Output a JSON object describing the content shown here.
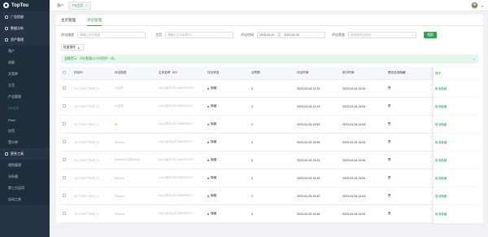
{
  "topbar": {
    "logo_text": "TopTou",
    "crumb_home": "落户",
    "crumb_tab": "FB主页",
    "crumb_tab_close": "×"
  },
  "sidebar": {
    "items": [
      {
        "label": "广告投放",
        "type": "group"
      },
      {
        "label": "数据分析",
        "type": "group"
      },
      {
        "label": "资产管理",
        "type": "group"
      },
      {
        "label": "落户",
        "type": "sub"
      },
      {
        "label": "创意",
        "type": "sub"
      },
      {
        "label": "文案库",
        "type": "sub"
      },
      {
        "label": "主页",
        "type": "sub"
      },
      {
        "label": "产品管理",
        "type": "sub"
      },
      {
        "label": "FB主页",
        "type": "sub",
        "active": true
      },
      {
        "label": "Pixel",
        "type": "sub"
      },
      {
        "label": "应用",
        "type": "sub"
      },
      {
        "label": "受众库",
        "type": "sub"
      },
      {
        "label": "更多工具",
        "type": "group"
      },
      {
        "label": "规则管理",
        "type": "sub"
      },
      {
        "label": "分析器",
        "type": "sub"
      },
      {
        "label": "第三方运用",
        "type": "sub"
      },
      {
        "label": "自动工具",
        "type": "sub"
      }
    ]
  },
  "tabs": [
    "主页管理",
    "评论管理"
  ],
  "filters": {
    "comment_label": "评论描述",
    "comment_placeholder": "请输入评论描述",
    "page_label": "主页",
    "page_placeholder": "请输入主页名称/ID",
    "time_label": "评论时间",
    "date_from": "2023-04-20",
    "date_to": "2023-04-26",
    "date_sep": "至",
    "status_label": "评论状态",
    "status_placeholder": "请选择评论状态",
    "search_button": "搜索"
  },
  "batch": {
    "label": "批量操作",
    "caret": "∨"
  },
  "alert": {
    "text": "温馨提示：评论数据12小时同步一次。",
    "close": "×"
  },
  "table": {
    "headers": [
      "",
      "评论ID",
      "评论描述",
      "主页名称（ID）",
      "评论状态",
      "点赞数",
      "评论时间",
      "执行时间",
      "是否支持隐藏",
      "操作"
    ],
    "rows": [
      {
        "id": "1071780773995_5...",
        "desc": "以后的",
        "page": "Lily以测试公司 11880498702?",
        "status": "隐藏",
        "likes": "0",
        "ctime": "2023-04-26 12:19",
        "etime": "2023-04-26 14:54",
        "hide": "是",
        "op": "取消隐藏"
      },
      {
        "id": "1071780773995_5...",
        "desc": "以后的",
        "page": "Lily以测试公司 11880498702?",
        "status": "隐藏",
        "likes": "0",
        "ctime": "2023-04-26 12:19",
        "etime": "2023-04-26 14:54",
        "hide": "是",
        "op": "取消隐藏"
      },
      {
        "id": "1071780773995_5...",
        "desc": "😀",
        "page": "Lily以测试公司 11880498702?",
        "status": "隐藏",
        "likes": "0",
        "ctime": "2023-04-25 15:59",
        "etime": "2023-04-26 14:54",
        "hide": "是",
        "op": "取消隐藏"
      },
      {
        "id": "1071780773995_5...",
        "desc": "Bulliant",
        "page": "Lily以测试公司 11880498702?",
        "status": "隐藏",
        "likes": "0",
        "ctime": "2023-04-25 15:59",
        "etime": "2023-04-26 14:54",
        "hide": "是",
        "op": "取消隐藏"
      },
      {
        "id": "1071780773995_5...",
        "desc": "Bulliant以后Bulliant",
        "page": "Lily以测试公司 11880498702?",
        "status": "隐藏",
        "likes": "0",
        "ctime": "2023-04-25 15:51",
        "etime": "2023-04-26 14:54",
        "hide": "是",
        "op": "取消隐藏"
      },
      {
        "id": "1071780773995_5...",
        "desc": "Bulliant",
        "page": "Lily以测试公司 11880498702?",
        "status": "隐藏",
        "likes": "0",
        "ctime": "2023-04-25 15:49",
        "etime": "2023-04-26 14:54",
        "hide": "是",
        "op": "取消隐藏"
      },
      {
        "id": "1071780773995_5...",
        "desc": "Bulliant",
        "page": "Lily以测试公司 11880498702?",
        "status": "隐藏",
        "likes": "0",
        "ctime": "2023-04-25 15:40",
        "etime": "2023-04-26 14:54",
        "hide": "是",
        "op": "取消隐藏"
      },
      {
        "id": "1071780773995_5...",
        "desc": "Bulliant",
        "page": "Lily以测试公司 11880498702?",
        "status": "隐藏",
        "likes": "0",
        "ctime": "2023-04-25 15:48",
        "etime": "2023-04-26 14:54",
        "hide": "是",
        "op": "取消隐藏"
      }
    ]
  },
  "colors": {
    "accent": "#2ea44f",
    "sidebar_bg": "#263445",
    "status_dot": "#e53935"
  }
}
